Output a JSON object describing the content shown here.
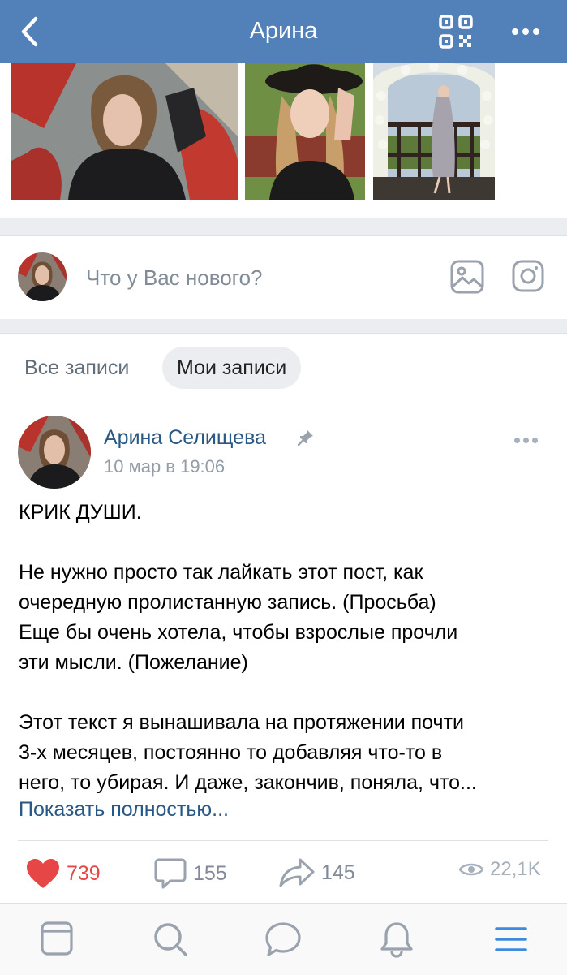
{
  "header": {
    "title": "Арина",
    "back_icon": "chevron-left-icon",
    "qr_icon": "qr-code-icon",
    "more_icon": "more-horizontal-icon",
    "color": "#5181b8"
  },
  "composer": {
    "placeholder": "Что у Вас нового?",
    "photo_icon": "photo-icon",
    "instagram_icon": "instagram-icon"
  },
  "tabs": [
    {
      "label": "Все записи",
      "active": false
    },
    {
      "label": "Мои записи",
      "active": true
    }
  ],
  "post": {
    "author": "Арина Селищева",
    "pinned": true,
    "date": "10 мар в 19:06",
    "title_line": "КРИК ДУШИ.",
    "paragraph1": [
      "Не нужно просто так лайкать этот пост, как",
      "очередную пролистанную запись. (Просьба)",
      "Еще бы очень хотела, чтобы взрослые прочли",
      "эти мысли. (Пожелание)"
    ],
    "paragraph2": [
      "Этот текст я вынашивала на протяжении почти",
      "3-х месяцев, постоянно то добавляя что-то в",
      "него, то убирая. И даже, закончив, поняла, что..."
    ],
    "show_more": "Показать полностью...",
    "likes": "739",
    "comments": "155",
    "shares": "145",
    "views": "22,1K",
    "like_color": "#e64646"
  },
  "tabbar": {
    "items": [
      "feed-icon",
      "search-icon",
      "messages-icon",
      "notifications-icon",
      "menu-icon"
    ],
    "active_color": "#3f8ae0",
    "inactive_color": "#99a2ad"
  }
}
